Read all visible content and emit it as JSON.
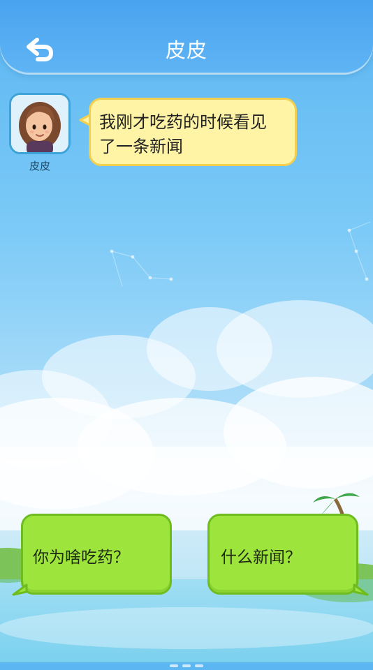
{
  "header": {
    "title": "皮皮",
    "back_icon": "back-arrow-icon"
  },
  "speaker": {
    "name": "皮皮",
    "message_line1": "我刚才吃药的时候看见",
    "message_line2": "了一条新闻"
  },
  "choices": [
    {
      "label": "你为啥吃药？"
    },
    {
      "label": "什么新闻？"
    }
  ],
  "colors": {
    "header": "#4aa3ef",
    "speech_bubble": "#fff3a6",
    "speech_border": "#f3cf4f",
    "choice_bubble": "#9de43d",
    "choice_border": "#6fbc20"
  }
}
